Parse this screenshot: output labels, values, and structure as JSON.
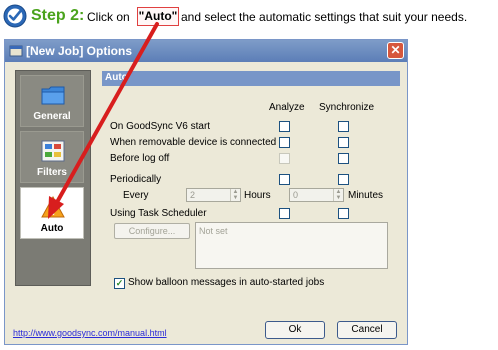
{
  "banner": {
    "step_title": "Step 2:",
    "text_before": "Click on",
    "highlight": "\"Auto\"",
    "text_after": "and select the automatic settings that suit your needs.",
    "title_color": "#4aa31c",
    "highlight_border_color": "#e04040"
  },
  "window": {
    "title": "[New Job] Options",
    "close_glyph": "✕"
  },
  "nav": {
    "items": [
      {
        "label": "General",
        "icon": "folder-icon",
        "selected": false
      },
      {
        "label": "Filters",
        "icon": "filters-icon",
        "selected": false
      },
      {
        "label": "Auto",
        "icon": "warning-icon",
        "selected": true
      }
    ]
  },
  "panel": {
    "header": "Auto",
    "col_analyze": "Analyze",
    "col_sync": "Synchronize",
    "rows": [
      {
        "label": "On GoodSync V6 start",
        "analyze": false,
        "sync": false
      },
      {
        "label": "When removable device is connected",
        "analyze": false,
        "sync": false
      },
      {
        "label": "Before log off",
        "analyze": false,
        "analyze_disabled": true,
        "sync": false
      },
      {
        "label": "Periodically",
        "analyze": false,
        "sync": false
      },
      {
        "label": "Using Task Scheduler",
        "analyze": false,
        "sync": false
      }
    ],
    "every_label": "Every",
    "hours_value": "2",
    "hours_label": "Hours",
    "minutes_value": "0",
    "minutes_label": "Minutes",
    "configure_label": "Configure...",
    "not_set": "Not set",
    "balloon_label": "Show balloon messages in auto-started jobs",
    "balloon_checked": true
  },
  "footer": {
    "link": "http://www.goodsync.com/manual.html",
    "ok": "Ok",
    "cancel": "Cancel"
  },
  "colors": {
    "arrow": "#d81e1e",
    "panel_header": "#7896c8",
    "titlebar": "#6c8cc0"
  }
}
